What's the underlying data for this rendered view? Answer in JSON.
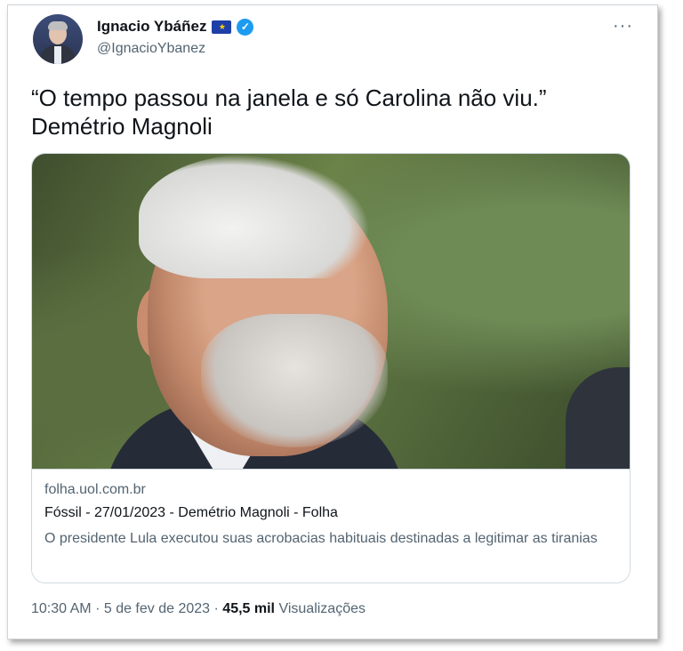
{
  "author": {
    "name": "Ignacio Ybáñez",
    "handle": "@IgnacioYbanez",
    "flag_icon": "eu-flag-icon",
    "verified_icon": "verified-badge-icon"
  },
  "more_label": "···",
  "tweet": {
    "line1": "“O tempo passou na janela e só Carolina não viu.”",
    "line2": "Demétrio Magnoli"
  },
  "link_card": {
    "domain": "folha.uol.com.br",
    "title": "Fóssil - 27/01/2023 - Demétrio Magnoli - Folha",
    "description": "O presidente Lula executou suas acrobacias habituais destinadas a legitimar as tiranias"
  },
  "footer": {
    "time": "10:30 AM",
    "separator": "·",
    "date": "5 de fev de 2023",
    "views_count": "45,5 mil",
    "views_label": "Visualizações"
  },
  "colors": {
    "text": "#0f1419",
    "secondary": "#536471",
    "verified": "#1d9bf0",
    "border": "#cfd9de"
  }
}
